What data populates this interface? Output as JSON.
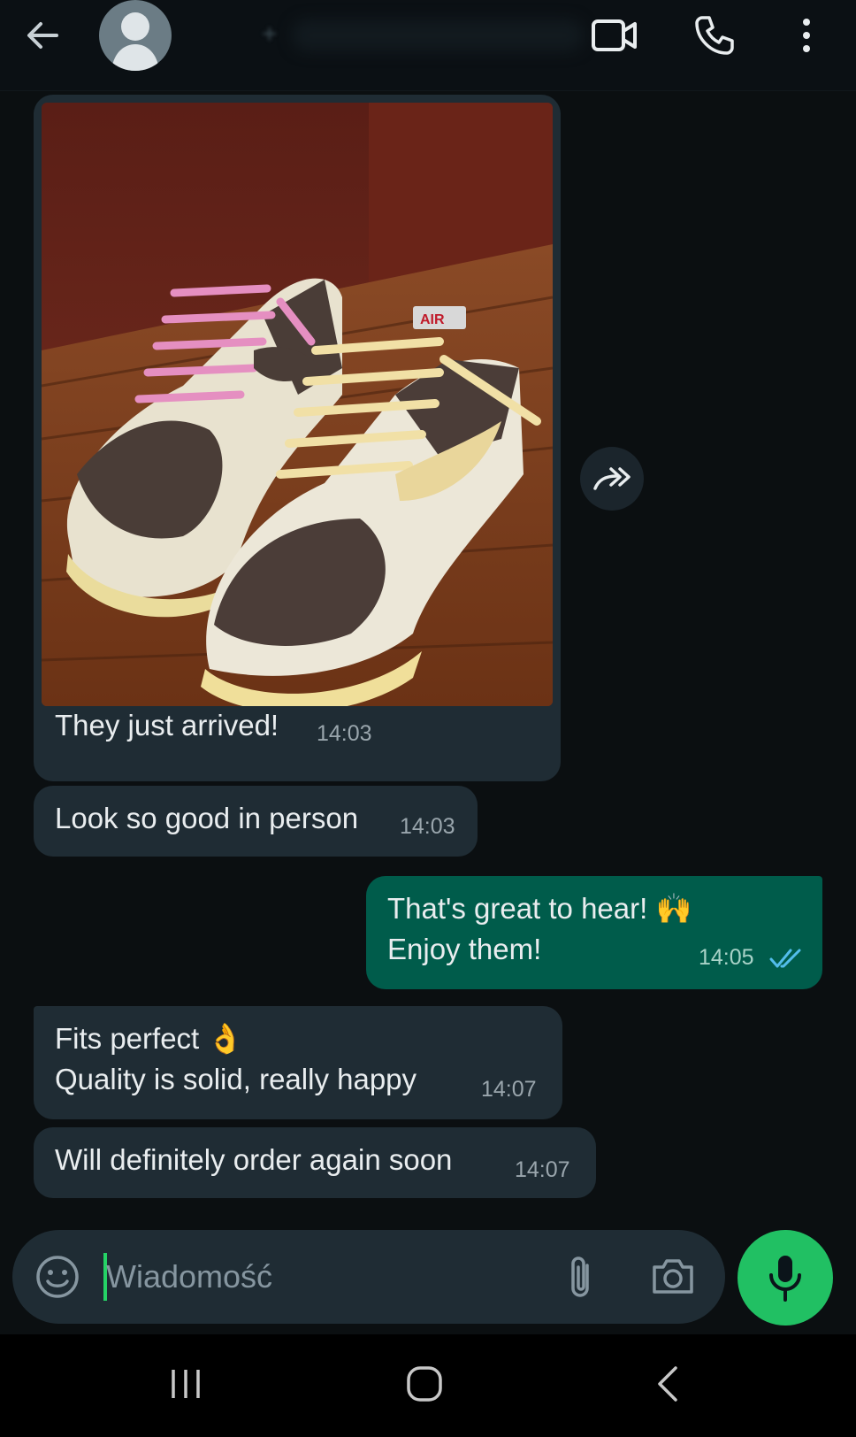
{
  "header": {
    "contact_name": "+",
    "icons": [
      "back-arrow-icon",
      "avatar-icon",
      "video-call-icon",
      "phone-icon",
      "more-vert-icon"
    ]
  },
  "messages": [
    {
      "id": "m1",
      "direction": "in",
      "has_image": true,
      "image_desc": "",
      "text": "They just arrived!",
      "time": "14:03"
    },
    {
      "id": "m2",
      "direction": "in",
      "text": "Look so good in person",
      "time": "14:03"
    },
    {
      "id": "m3",
      "direction": "out",
      "text": "That's great to hear! 🙌\nEnjoy them!",
      "time": "14:05",
      "status": "read"
    },
    {
      "id": "m4",
      "direction": "in",
      "text": "Fits perfect 👌\nQuality is solid, really happy",
      "time": "14:07"
    },
    {
      "id": "m5",
      "direction": "in",
      "text": "Will definitely order again soon",
      "time": "14:07"
    }
  ],
  "composer": {
    "placeholder": "Wiadomość",
    "icons": [
      "emoji-icon",
      "attach-icon",
      "camera-icon",
      "mic-icon"
    ]
  },
  "colors": {
    "accent": "#21c063",
    "incoming_bubble": "#1f2c34",
    "outgoing_bubble": "#005c4b",
    "read_ticks": "#53bdeb",
    "background": "#0b0f11"
  }
}
